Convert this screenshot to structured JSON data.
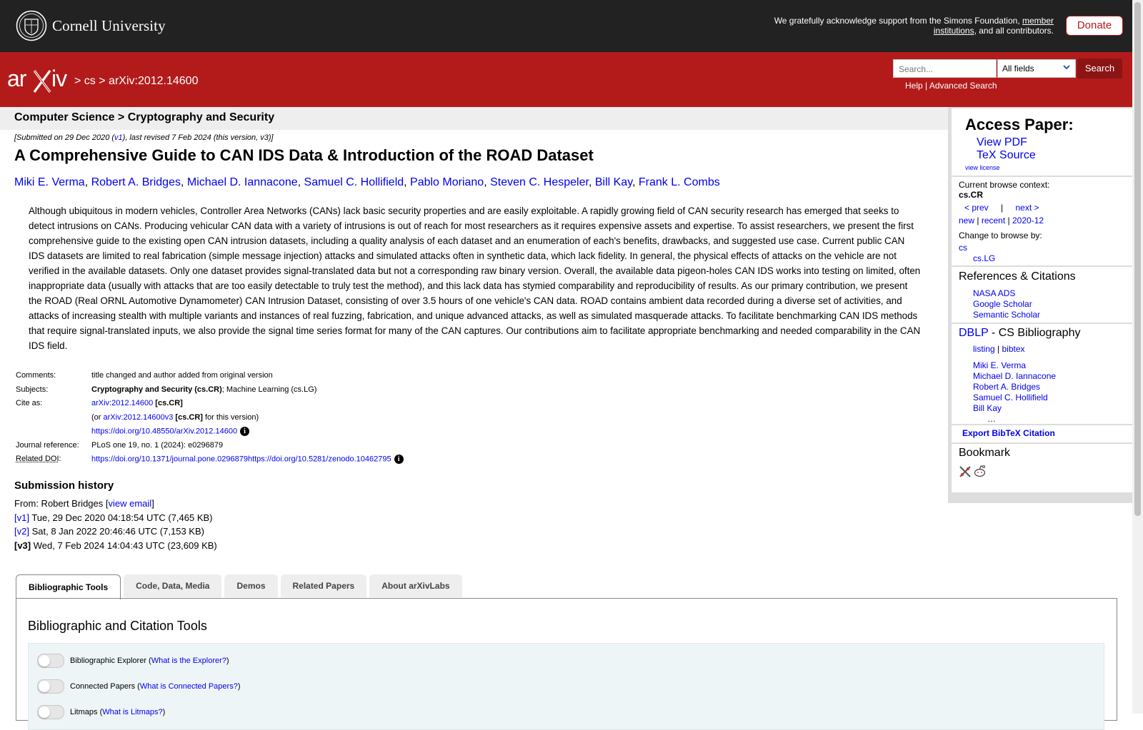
{
  "header": {
    "institution": "Cornell University",
    "support_text": "We gratefully acknowledge support from the Simons Foundation, ",
    "member_link": "member institutions",
    "support_suffix": ", and all contributors.",
    "donate": "Donate"
  },
  "nav": {
    "logo": "arXiv",
    "sep1": ">",
    "crumb_cs": "cs",
    "sep2": ">",
    "crumb_id": "arXiv:2012.14600",
    "search_placeholder": "Search...",
    "field_select": "All fields",
    "search_button": "Search",
    "help": "Help",
    "pipe": "|",
    "advanced": "Advanced Search"
  },
  "subheader": "Computer Science > Cryptography and Security",
  "paper": {
    "dateline_prefix": "[Submitted on 29 Dec 2020 (",
    "dateline_v1": "v1",
    "dateline_suffix": "), last revised 7 Feb 2024 (this version, v3)]",
    "title": "A Comprehensive Guide to CAN IDS Data & Introduction of the ROAD Dataset",
    "authors": [
      "Miki E. Verma",
      "Robert A. Bridges",
      "Michael D. Iannacone",
      "Samuel C. Hollifield",
      "Pablo Moriano",
      "Steven C. Hespeler",
      "Bill Kay",
      "Frank L. Combs"
    ],
    "abstract": "Although ubiquitous in modern vehicles, Controller Area Networks (CANs) lack basic security properties and are easily exploitable. A rapidly growing field of CAN security research has emerged that seeks to detect intrusions on CANs. Producing vehicular CAN data with a variety of intrusions is out of reach for most researchers as it requires expensive assets and expertise. To assist researchers, we present the first comprehensive guide to the existing open CAN intrusion datasets, including a quality analysis of each dataset and an enumeration of each's benefits, drawbacks, and suggested use case. Current public CAN IDS datasets are limited to real fabrication (simple message injection) attacks and simulated attacks often in synthetic data, which lack fidelity. In general, the physical effects of attacks on the vehicle are not verified in the available datasets. Only one dataset provides signal-translated data but not a corresponding raw binary version. Overall, the available data pigeon-holes CAN IDS works into testing on limited, often inappropriate data (usually with attacks that are too easily detectable to truly test the method), and this lack data has stymied comparability and reproducibility of results. As our primary contribution, we present the ROAD (Real ORNL Automotive Dynamometer) CAN Intrusion Dataset, consisting of over 3.5 hours of one vehicle's CAN data. ROAD contains ambient data recorded during a diverse set of activities, and attacks of increasing stealth with multiple variants and instances of real fuzzing, fabrication, and unique advanced attacks, as well as simulated masquerade attacks. To facilitate benchmarking CAN IDS methods that require signal-translated inputs, we also provide the signal time series format for many of the CAN captures. Our contributions aim to facilitate appropriate benchmarking and needed comparability in the CAN IDS field."
  },
  "meta": {
    "comments_label": "Comments:",
    "comments": "title changed and author added from original version",
    "subjects_label": "Subjects:",
    "subjects_primary": "Cryptography and Security (cs.CR)",
    "subjects_rest": "; Machine Learning (cs.LG)",
    "cite_label": "Cite as:",
    "cite_id": "arXiv:2012.14600",
    "cite_cat": "[cs.CR]",
    "cite2_prefix": "(or ",
    "cite2_id": "arXiv:2012.14600v3",
    "cite2_cat": "[cs.CR]",
    "cite2_suffix": " for this version)",
    "doi": "https://doi.org/10.48550/arXiv.2012.14600",
    "journal_label": "Journal reference:",
    "journal": "PLoS one 19, no. 1 (2024): e0296879",
    "related_label": "Related DOI",
    "related_colon": ":",
    "related": "https://doi.org/10.1371/journal.pone.0296879https://doi.org/10.5281/zenodo.10462795",
    "info_glyph": "i"
  },
  "history": {
    "title": "Submission history",
    "from_prefix": "From: Robert Bridges [",
    "view_email": "view email",
    "from_suffix": "]",
    "versions": [
      {
        "tag": "[v1]",
        "text": " Tue, 29 Dec 2020 04:18:54 UTC (7,465 KB)"
      },
      {
        "tag": "[v2]",
        "text": " Sat, 8 Jan 2022 20:46:46 UTC (7,153 KB)"
      },
      {
        "tag": "[v3]",
        "text": " Wed, 7 Feb 2024 14:04:43 UTC (23,609 KB)"
      }
    ]
  },
  "tabs": [
    "Bibliographic Tools",
    "Code, Data, Media",
    "Demos",
    "Related Papers",
    "About arXivLabs"
  ],
  "tools": {
    "title": "Bibliographic and Citation Tools",
    "rows": [
      {
        "label": "Bibliographic Explorer (",
        "link": "What is the Explorer?",
        "end": ")"
      },
      {
        "label": "Connected Papers (",
        "link": "What is Connected Papers?",
        "end": ")"
      },
      {
        "label": "Litmaps (",
        "link": "What is Litmaps?",
        "end": ")"
      }
    ]
  },
  "sidebar": {
    "access_title": "Access Paper:",
    "view_pdf": "View PDF",
    "tex_source": "TeX Source",
    "view_license": "view license",
    "browse_label": "Current browse context:",
    "browse_ctx": "cs.CR",
    "prev": "< prev",
    "bar": "|",
    "next": "next >",
    "new": "new",
    "recent": "recent",
    "month": "2020-12",
    "change_label": "Change to browse by:",
    "cs": "cs",
    "cslg": "cs.LG",
    "refs_title": "References & Citations",
    "refs": [
      "NASA ADS",
      "Google Scholar",
      "Semantic Scholar"
    ],
    "dblp": "DBLP",
    "dblp_suffix": " - CS Bibliography",
    "listing": "listing",
    "bibtex": "bibtex",
    "dblp_authors": [
      "Miki E. Verma",
      "Michael D. Iannacone",
      "Robert A. Bridges",
      "Samuel C. Hollifield",
      "Bill Kay"
    ],
    "ellipsis": "…",
    "export": "Export BibTeX Citation",
    "bookmark": "Bookmark"
  }
}
